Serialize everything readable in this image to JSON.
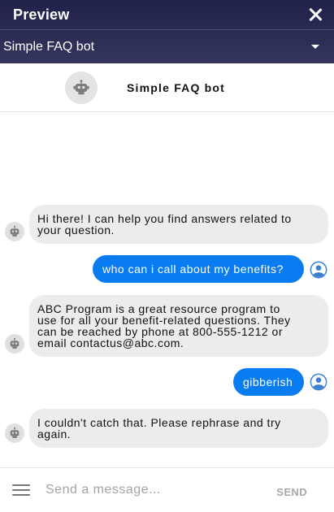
{
  "window": {
    "title": "Preview"
  },
  "bot_selector": {
    "selected": "Simple FAQ bot"
  },
  "chat_header": {
    "bot_name": "Simple FAQ bot"
  },
  "messages": [
    {
      "sender": "bot",
      "lines": [
        "Hi there! I can help you find answers related to",
        "your question."
      ]
    },
    {
      "sender": "user",
      "lines": [
        "who can i call about my benefits?"
      ]
    },
    {
      "sender": "bot",
      "lines": [
        "ABC Program is a great resource program to",
        "use for all your benefit-related questions. They",
        "can be reached by phone at 800-555-1212 or",
        "email contactus@abc.com."
      ]
    },
    {
      "sender": "user",
      "lines": [
        "gibberish"
      ]
    },
    {
      "sender": "bot",
      "lines": [
        "I couldn't catch that. Please rephrase and try",
        "again."
      ]
    }
  ],
  "composer": {
    "placeholder": "Send a message...",
    "send_label": "SEND"
  },
  "colors": {
    "header_bg": "#2c2d55",
    "user_bubble": "#0a7cf2",
    "bot_bubble": "#ececec"
  },
  "icons": {
    "close": "close-icon",
    "dropdown": "chevron-down-icon",
    "bot": "robot-icon",
    "user": "user-icon",
    "menu": "menu-icon"
  }
}
